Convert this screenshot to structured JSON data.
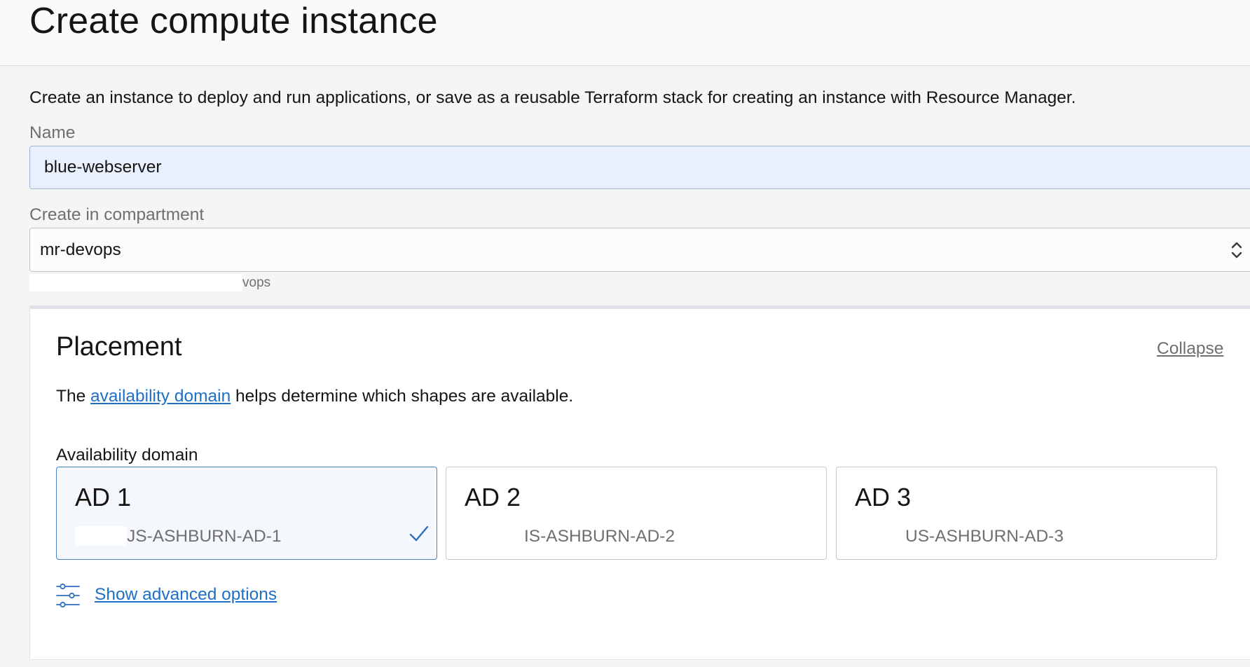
{
  "header": {
    "title": "Create compute instance"
  },
  "intro_text": "Create an instance to deploy and run applications, or save as a reusable Terraform stack for creating an instance with Resource Manager.",
  "name_field": {
    "label": "Name",
    "value": "blue-webserver"
  },
  "compartment": {
    "label": "Create in compartment",
    "value": "mr-devops",
    "path_tail": "vops"
  },
  "placement": {
    "title": "Placement",
    "collapse_label": "Collapse",
    "help_prefix": "The ",
    "help_link": "availability domain",
    "help_suffix": " helps determine which shapes are available.",
    "ad_label": "Availability domain",
    "domains": [
      {
        "title": "AD 1",
        "subtitle": "JS-ASHBURN-AD-1",
        "selected": true
      },
      {
        "title": "AD 2",
        "subtitle": "IS-ASHBURN-AD-2",
        "selected": false
      },
      {
        "title": "AD 3",
        "subtitle": "US-ASHBURN-AD-3",
        "selected": false
      }
    ],
    "advanced_label": "Show advanced options"
  },
  "colors": {
    "link": "#1f6fc5",
    "selected_border": "#4b83c4",
    "name_input_bg": "#e8f0fe",
    "page_bg": "#f5f5f5"
  },
  "icons": {
    "compartment_select": "chevron-up-down-icon",
    "selected_domain": "check-icon",
    "advanced_options": "sliders-icon"
  }
}
